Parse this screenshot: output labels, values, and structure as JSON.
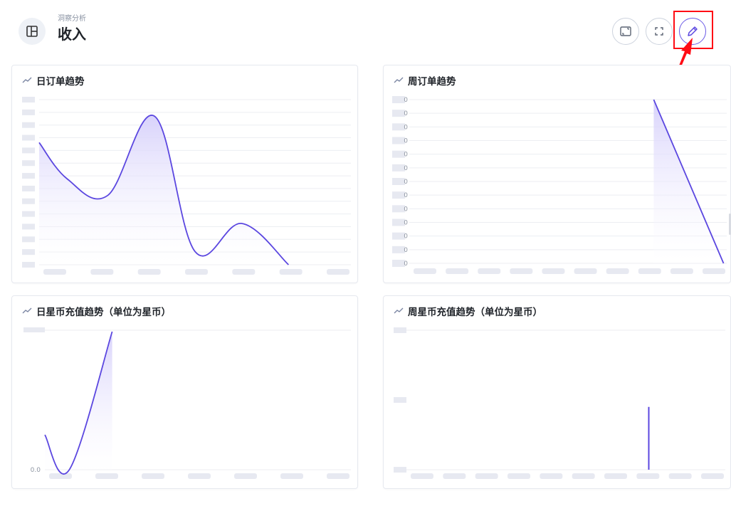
{
  "header": {
    "breadcrumb": "洞察分析",
    "title": "收入",
    "icon": "layout-icon",
    "buttons": [
      {
        "name": "screen-adapt-button",
        "icon": "screen-icon"
      },
      {
        "name": "fullscreen-button",
        "icon": "fullscreen-icon"
      },
      {
        "name": "edit-button",
        "icon": "pencil-icon"
      }
    ]
  },
  "colors": {
    "accent": "#5b47e0",
    "fill_top": "#d6d0fb",
    "grid": "#eceef2",
    "highlight": "#ff0b14"
  },
  "cards": [
    {
      "id": "daily-orders",
      "title": "日订单趋势",
      "chart_data": {
        "type": "area",
        "title": "日订单趋势",
        "x_count": 7,
        "y_tick_count": 14,
        "points": [
          [
            0,
            0.74
          ],
          [
            0.09,
            0.52
          ],
          [
            0.22,
            0.42
          ],
          [
            0.37,
            0.9
          ],
          [
            0.5,
            0.08
          ],
          [
            0.65,
            0.25
          ],
          [
            0.8,
            0.0
          ]
        ],
        "ylim": [
          0,
          1
        ],
        "grid": true,
        "legend": "none"
      }
    },
    {
      "id": "weekly-orders",
      "title": "周订单趋势",
      "chart_data": {
        "type": "area",
        "title": "周订单趋势",
        "y_tick_labels": [
          "0",
          "0",
          "0",
          "0",
          "0",
          "0",
          "0",
          "0",
          "0",
          "0",
          "0",
          "0",
          "0"
        ],
        "x_count": 10,
        "points": [
          [
            0.77,
            1.0
          ],
          [
            0.99,
            0.0
          ]
        ],
        "ylim": [
          0,
          1
        ],
        "grid": true,
        "legend": "none"
      }
    },
    {
      "id": "daily-stars",
      "title": "日星币充值趋势（单位为星币）",
      "chart_data": {
        "type": "area",
        "title": "日星币充值趋势（单位为星币）",
        "y_tick_labels": [
          "0.0"
        ],
        "x_count": 7,
        "points": [
          [
            0,
            0.25
          ],
          [
            0.08,
            0.0
          ],
          [
            0.22,
            0.99
          ]
        ],
        "ylim": [
          0,
          1
        ],
        "grid": true,
        "legend": "none"
      }
    },
    {
      "id": "weekly-stars",
      "title": "周星币充值趋势（单位为星币）",
      "chart_data": {
        "type": "bar",
        "title": "周星币充值趋势（单位为星币）",
        "x_count": 10,
        "points": [
          [
            0.76,
            0.45
          ]
        ],
        "ylim": [
          0,
          1
        ],
        "grid": true,
        "legend": "none"
      }
    }
  ]
}
